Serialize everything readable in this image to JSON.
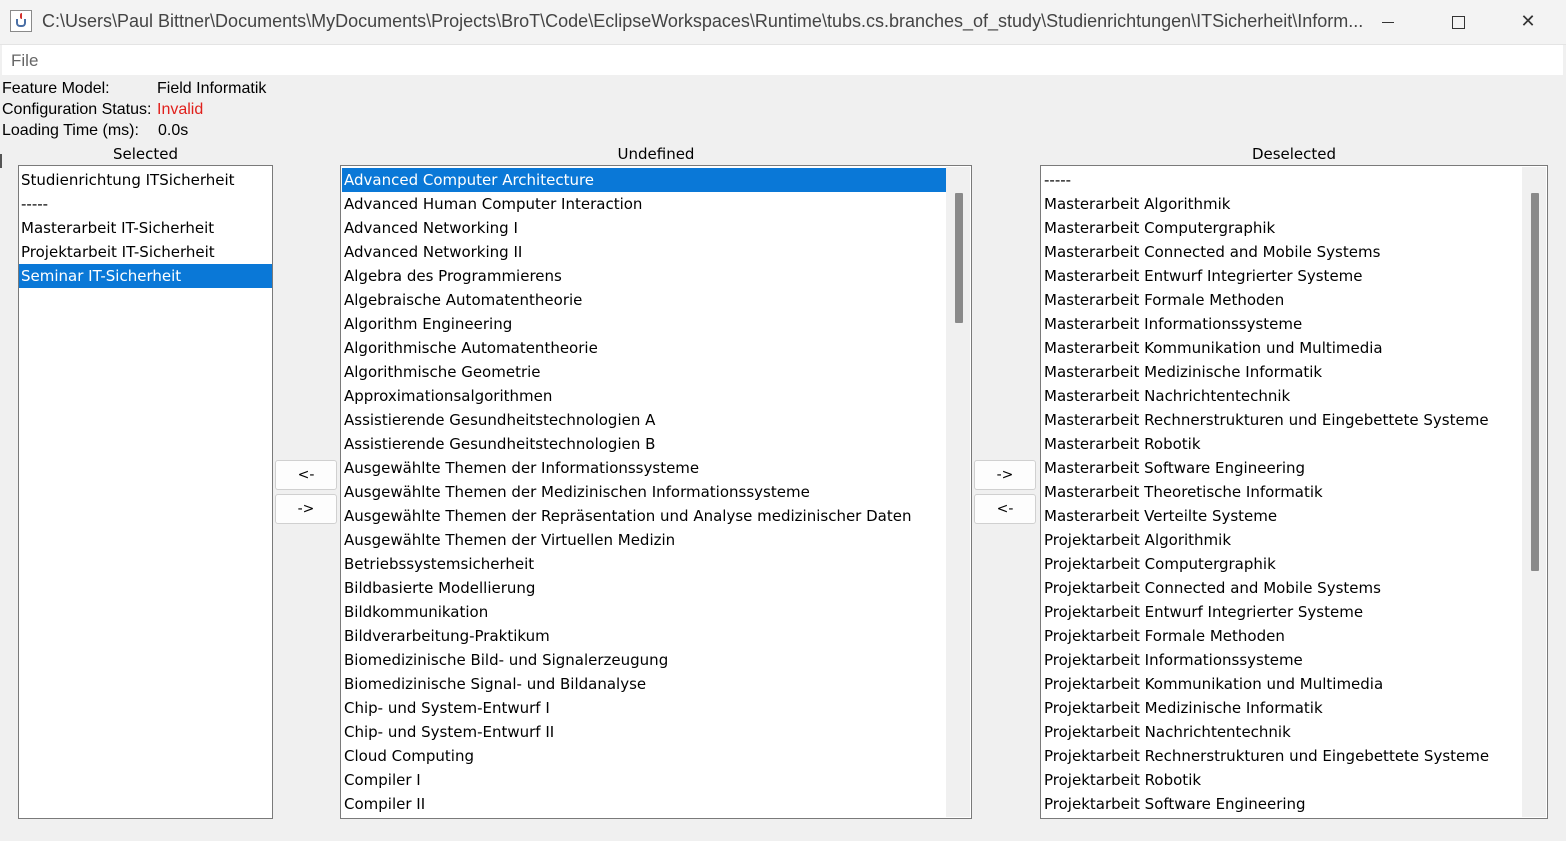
{
  "window": {
    "title": "C:\\Users\\Paul Bittner\\Documents\\MyDocuments\\Projects\\BroT\\Code\\EclipseWorkspaces\\Runtime\\tubs.cs.branches_of_study\\Studienrichtungen\\ITSicherheit\\Inform...",
    "icon": "java-app-icon",
    "minimize_icon": "minimize-icon",
    "maximize_icon": "maximize-icon",
    "close_icon": "close-icon"
  },
  "menu": {
    "file": "File"
  },
  "info": {
    "feature_model_label": "Feature Model:",
    "feature_model_value": "Field Informatik",
    "status_label": "Configuration Status:",
    "status_value": "Invalid",
    "status_color": "#e0201c",
    "loading_label": "Loading Time (ms):",
    "loading_value": "0.0s"
  },
  "columns": {
    "selected": "Selected",
    "undefined": "Undefined",
    "deselected": "Deselected"
  },
  "selected_list": {
    "items": [
      "Studienrichtung ITSicherheit",
      "-----",
      "Masterarbeit IT-Sicherheit",
      "Projektarbeit IT-Sicherheit",
      "Seminar IT-Sicherheit"
    ],
    "highlighted_index": 4
  },
  "undefined_list": {
    "items": [
      "Advanced Computer Architecture",
      "Advanced Human Computer Interaction",
      "Advanced Networking I",
      "Advanced Networking II",
      "Algebra des Programmierens",
      "Algebraische Automatentheorie",
      "Algorithm Engineering",
      "Algorithmische Automatentheorie",
      "Algorithmische Geometrie",
      "Approximationsalgorithmen",
      "Assistierende Gesundheitstechnologien A",
      "Assistierende Gesundheitstechnologien B",
      "Ausgewählte Themen der Informationssysteme",
      "Ausgewählte Themen der Medizinischen Informationssysteme",
      "Ausgewählte Themen der Repräsentation und Analyse medizinischer Daten",
      "Ausgewählte Themen der Virtuellen Medizin",
      "Betriebssystemsicherheit",
      "Bildbasierte Modellierung",
      "Bildkommunikation",
      "Bildverarbeitung-Praktikum",
      "Biomedizinische Bild- und Signalerzeugung",
      "Biomedizinische Signal- und Bildanalyse",
      "Chip- und System-Entwurf I",
      "Chip- und System-Entwurf II",
      "Cloud Computing",
      "Compiler I",
      "Compiler II"
    ],
    "highlighted_index": 0,
    "scroll_fraction": 0.0
  },
  "deselected_list": {
    "items": [
      "-----",
      "Masterarbeit Algorithmik",
      "Masterarbeit Computergraphik",
      "Masterarbeit Connected and Mobile Systems",
      "Masterarbeit Entwurf Integrierter Systeme",
      "Masterarbeit Formale Methoden",
      "Masterarbeit Informationssysteme",
      "Masterarbeit Kommunikation und Multimedia",
      "Masterarbeit Medizinische Informatik",
      "Masterarbeit Nachrichtentechnik",
      "Masterarbeit Rechnerstrukturen und Eingebettete Systeme",
      "Masterarbeit Robotik",
      "Masterarbeit Software Engineering",
      "Masterarbeit Theoretische Informatik",
      "Masterarbeit Verteilte Systeme",
      "Projektarbeit Algorithmik",
      "Projektarbeit Computergraphik",
      "Projektarbeit Connected and Mobile Systems",
      "Projektarbeit Entwurf Integrierter Systeme",
      "Projektarbeit Formale Methoden",
      "Projektarbeit Informationssysteme",
      "Projektarbeit Kommunikation und Multimedia",
      "Projektarbeit Medizinische Informatik",
      "Projektarbeit Nachrichtentechnik",
      "Projektarbeit Rechnerstrukturen und Eingebettete Systeme",
      "Projektarbeit Robotik",
      "Projektarbeit Software Engineering"
    ],
    "highlighted_index": -1,
    "scroll_fraction": 0.0
  },
  "buttons": {
    "left_to_selected": "<-",
    "left_to_undefined": "->",
    "right_to_deselected": "->",
    "right_to_undefined": "<-"
  },
  "colors": {
    "selection": "#0a78d7",
    "background": "#f0f0f0",
    "list_background": "#ffffff"
  }
}
